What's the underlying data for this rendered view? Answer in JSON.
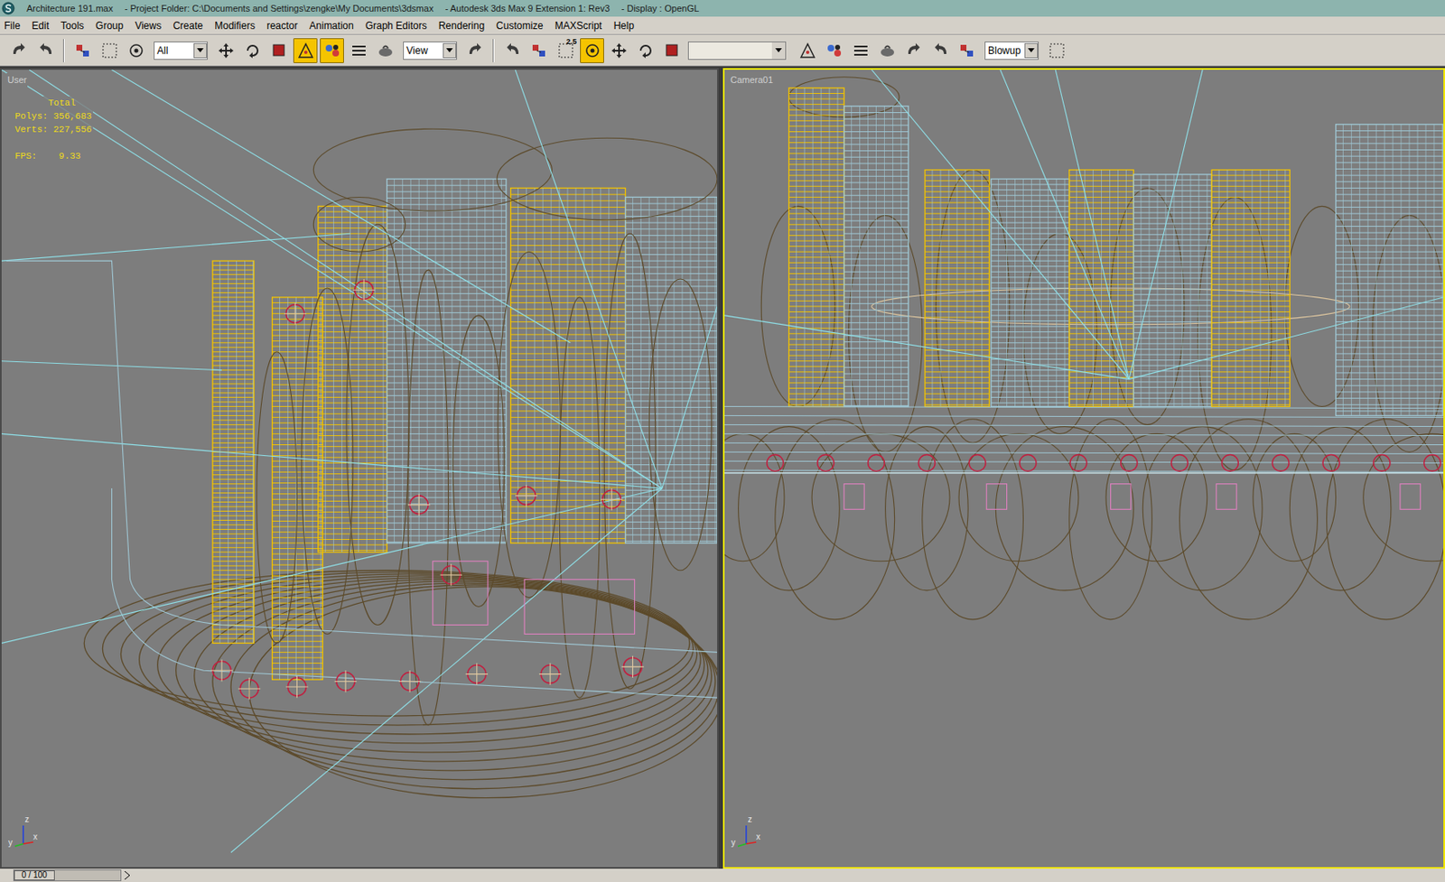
{
  "window": {
    "title_parts": [
      "Architecture 191.max",
      "- Project Folder: C:\\Documents and Settings\\zengke\\My Documents\\3dsmax",
      "- Autodesk 3ds Max 9 Extension 1: Rev3",
      "- Display : OpenGL"
    ]
  },
  "menu": [
    "File",
    "Edit",
    "Tools",
    "Group",
    "Views",
    "Create",
    "Modifiers",
    "reactor",
    "Animation",
    "Graph Editors",
    "Rendering",
    "Customize",
    "MAXScript",
    "Help"
  ],
  "toolbar": [
    {
      "kind": "button",
      "active": false
    },
    {
      "kind": "button",
      "active": false
    },
    {
      "kind": "separator"
    },
    {
      "kind": "button",
      "active": false
    },
    {
      "kind": "button",
      "active": false
    },
    {
      "kind": "button",
      "active": false
    },
    {
      "kind": "dropdown",
      "value": "All"
    },
    {
      "kind": "button",
      "active": false
    },
    {
      "kind": "button",
      "active": false
    },
    {
      "kind": "button",
      "active": false
    },
    {
      "kind": "button",
      "active": true
    },
    {
      "kind": "button",
      "active": true
    },
    {
      "kind": "button",
      "active": false
    },
    {
      "kind": "button",
      "active": false
    },
    {
      "kind": "dropdown",
      "value": "View"
    },
    {
      "kind": "button",
      "active": false
    },
    {
      "kind": "separator"
    },
    {
      "kind": "button",
      "active": false
    },
    {
      "kind": "button",
      "active": false
    },
    {
      "kind": "button",
      "active": false,
      "label": "2.5"
    },
    {
      "kind": "button",
      "active": true
    },
    {
      "kind": "button",
      "active": false
    },
    {
      "kind": "button",
      "active": false
    },
    {
      "kind": "button",
      "active": false
    },
    {
      "kind": "field",
      "value": ""
    },
    {
      "kind": "button",
      "active": false
    },
    {
      "kind": "button",
      "active": false
    },
    {
      "kind": "button",
      "active": false
    },
    {
      "kind": "button",
      "active": false
    },
    {
      "kind": "button",
      "active": false
    },
    {
      "kind": "button",
      "active": false
    },
    {
      "kind": "button",
      "active": false
    },
    {
      "kind": "dropdown",
      "value": "Blowup"
    },
    {
      "kind": "button",
      "active": false
    }
  ],
  "viewports": [
    {
      "label": "User",
      "active": false,
      "stats": {
        "heading": "Total",
        "lines": [
          "Polys: 356,683",
          "Verts: 227,556"
        ],
        "fps": "FPS:    9.33"
      },
      "axis": [
        "z",
        "y",
        "x"
      ]
    },
    {
      "label": "Camera01",
      "active": true,
      "axis": [
        "z",
        "y",
        "x"
      ]
    }
  ],
  "timeline": {
    "position": "0 / 100",
    "level": 0
  }
}
